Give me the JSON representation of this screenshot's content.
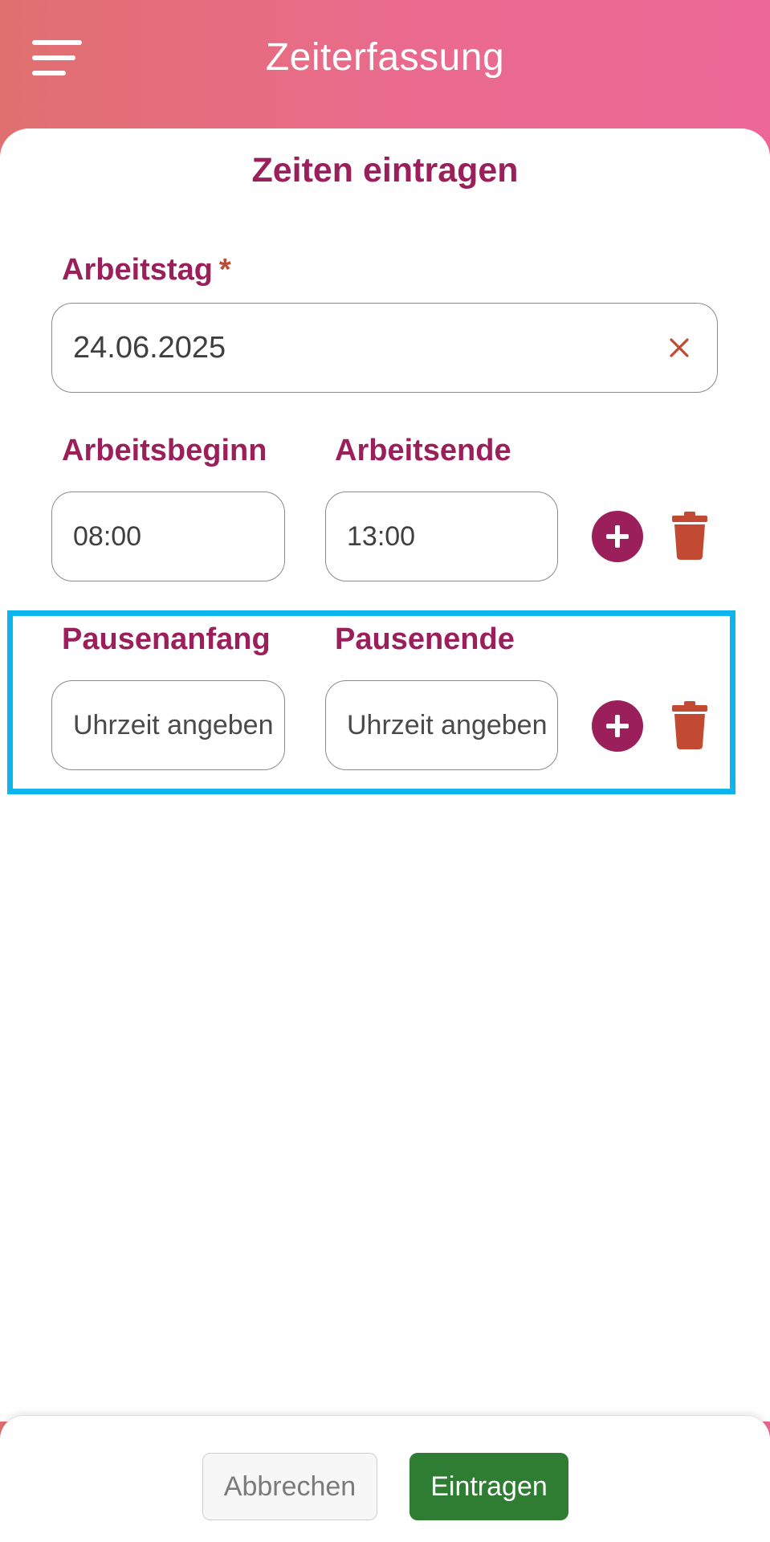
{
  "header": {
    "title": "Zeiterfassung",
    "menu_icon": "hamburger-menu-icon",
    "gradient_colors": [
      "#e0706f",
      "#ec6796"
    ]
  },
  "form": {
    "title": "Zeiten eintragen",
    "workday": {
      "label": "Arbeitstag",
      "required_marker": "*",
      "value": "24.06.2025",
      "clear_icon": "close-icon"
    },
    "work_time": {
      "start_label": "Arbeitsbeginn",
      "end_label": "Arbeitsende",
      "start_value": "08:00",
      "end_value": "13:00"
    },
    "break_time": {
      "start_label": "Pausenanfang",
      "end_label": "Pausenende",
      "start_placeholder": "Uhrzeit angeben",
      "end_placeholder": "Uhrzeit angeben"
    },
    "add_icon": "plus-circle-icon",
    "delete_icon": "trash-icon"
  },
  "footer": {
    "cancel_label": "Abbrechen",
    "submit_label": "Eintragen"
  },
  "colors": {
    "accent": "#9b1f5a",
    "danger": "#c24a33",
    "success": "#2e7d32",
    "highlight": "#0db5ec"
  }
}
